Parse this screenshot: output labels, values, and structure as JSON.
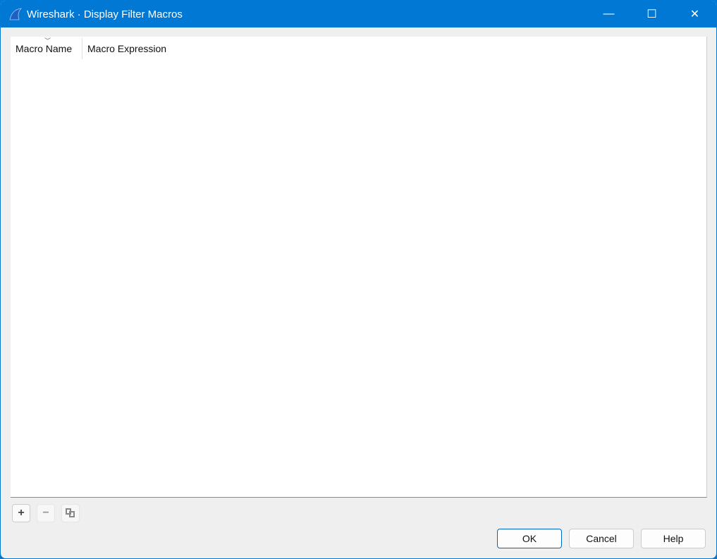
{
  "window": {
    "title": "Wireshark · Display Filter Macros",
    "minimize": "—",
    "maximize": "☐",
    "close": "✕"
  },
  "table": {
    "columns": [
      "Macro Name",
      "Macro Expression"
    ],
    "rows": []
  },
  "toolbar": {
    "add": "+",
    "remove": "−"
  },
  "buttons": {
    "ok": "OK",
    "cancel": "Cancel",
    "help": "Help"
  }
}
